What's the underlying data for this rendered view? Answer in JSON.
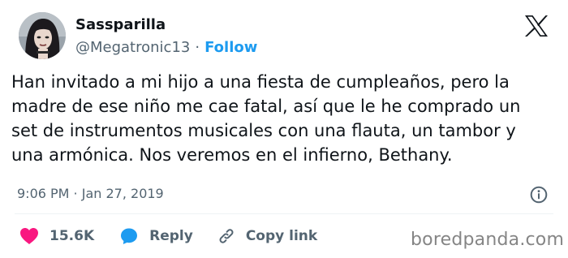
{
  "author": {
    "display_name": "Sassparilla",
    "handle": "@Megatronic13",
    "separator": "·",
    "follow_label": "Follow"
  },
  "tweet": {
    "lines": [
      "Han invitado a mi hijo a una fiesta de cumpleaños, pero la",
      "madre de ese niño me cae fatal, así que le he comprado un",
      "set de instrumentos musicales con una flauta, un tambor y",
      "una armónica. Nos veremos en el infierno, Bethany."
    ],
    "timestamp": "9:06 PM · Jan 27, 2019"
  },
  "actions": {
    "likes_count": "15.6K",
    "reply_label": "Reply",
    "copy_link_label": "Copy link"
  },
  "watermark": "boredpanda.com",
  "icons": {
    "logo": "x-logo-icon",
    "info": "info-icon",
    "like": "heart-icon",
    "reply": "speech-bubble-icon",
    "copy_link": "link-icon"
  },
  "colors": {
    "text_primary": "#0f1419",
    "text_secondary": "#536471",
    "accent": "#1d9bf0",
    "like": "#f91880",
    "watermark": "#858585"
  }
}
